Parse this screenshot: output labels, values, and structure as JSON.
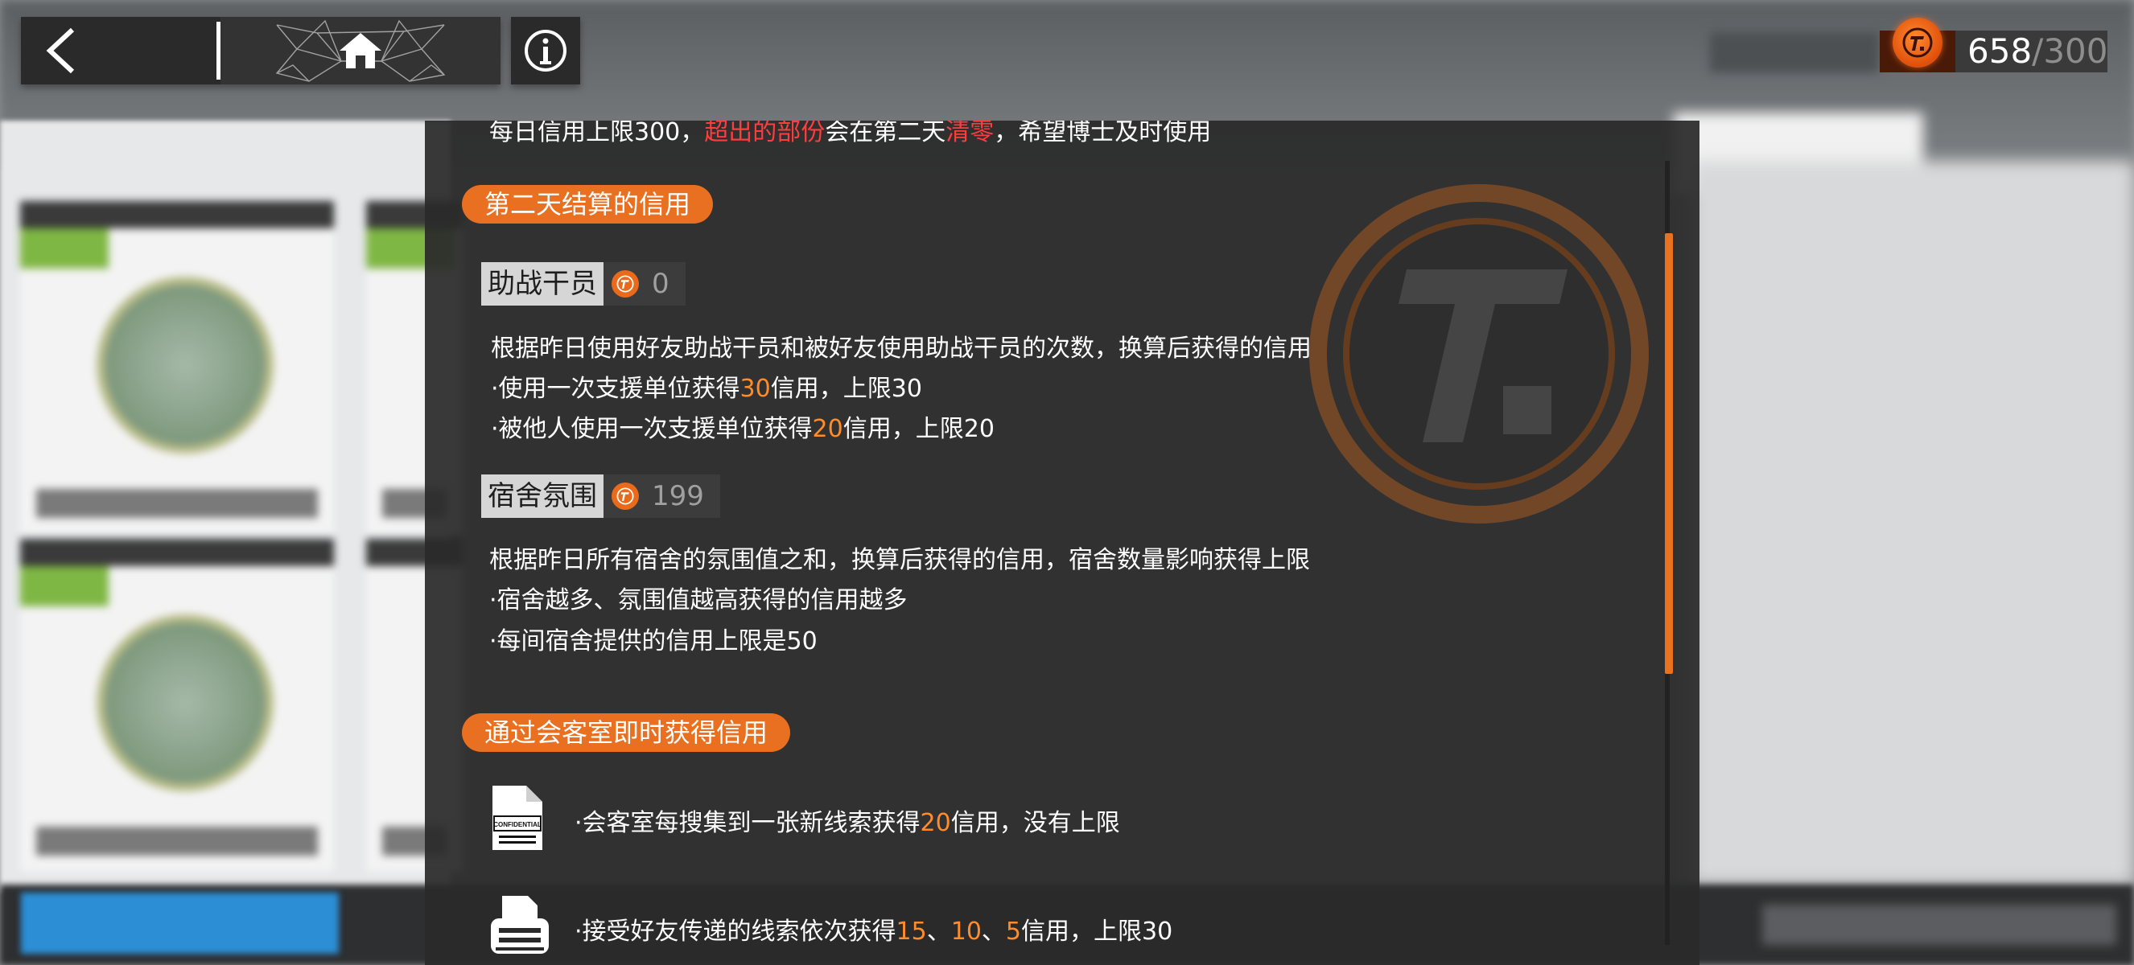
{
  "header": {
    "back_icon": "chevron-left-icon",
    "home_icon": "home-icon",
    "info_icon": "info-icon",
    "credits": {
      "current": "658",
      "separator": "/",
      "limit": "300",
      "icon": "credit-coin-icon"
    }
  },
  "modal": {
    "top_line": {
      "part1": "每日信用上限300，",
      "part2": "超出的部份",
      "part3": "会在第二天",
      "part4": "清零",
      "part5": "，希望博士及时使用"
    },
    "section1": {
      "title": "第二天结算的信用",
      "assist": {
        "label": "助战干员",
        "value": "0",
        "desc": "根据昨日使用好友助战干员和被好友使用助战干员的次数，换算后获得的信用",
        "line1": {
          "pre": "·使用一次支援单位获得",
          "num": "30",
          "post": "信用，上限30"
        },
        "line2": {
          "pre": "·被他人使用一次支援单位获得",
          "num": "20",
          "post": "信用，上限20"
        }
      },
      "dorm": {
        "label": "宿舍氛围",
        "value": "199",
        "desc": "根据昨日所有宿舍的氛围值之和，换算后获得的信用，宿舍数量影响获得上限",
        "line1": "·宿舍越多、氛围值越高获得的信用越多",
        "line2": "·每间宿舍提供的信用上限是50"
      }
    },
    "section2": {
      "title": "通过会客室即时获得信用",
      "clue": {
        "icon": "confidential-document-icon",
        "stamp": "CONFIDENTIAL",
        "pre": "·会客室每搜集到一张新线索获得",
        "num": "20",
        "post": "信用，没有上限"
      },
      "transfer": {
        "icon": "printer-icon",
        "pre": "·接受好友传递的线索依次获得",
        "n1": "15",
        "sep1": "、",
        "n2": "10",
        "sep2": "、",
        "n3": "5",
        "post": "信用，上限30"
      }
    }
  },
  "colors": {
    "accent": "#e87020",
    "highlight_red": "#ff3d3d",
    "highlight_orange": "#ff8c29"
  }
}
